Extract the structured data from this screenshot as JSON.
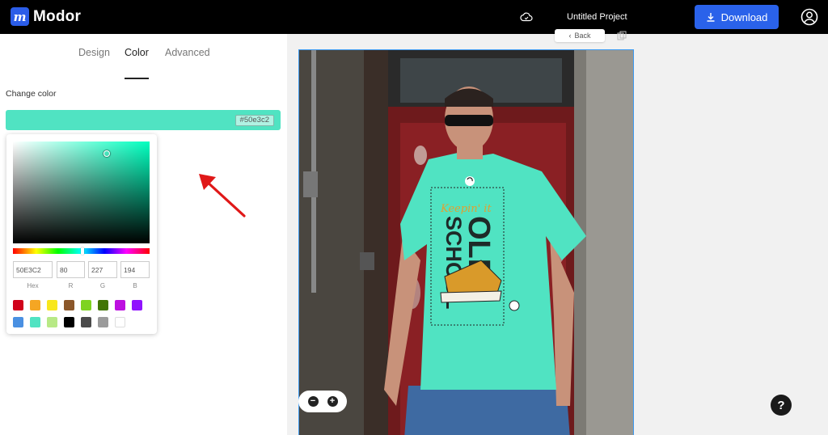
{
  "app": {
    "logo_letter": "m",
    "name": "Modor"
  },
  "header": {
    "project_name": "Untitled Project",
    "download_label": "Download",
    "icons": [
      "cloud-icon",
      "download-icon",
      "user-icon"
    ]
  },
  "tabs": [
    {
      "label": "Design",
      "active": false
    },
    {
      "label": "Color",
      "active": true
    },
    {
      "label": "Advanced",
      "active": false
    }
  ],
  "color_panel": {
    "label": "Change color",
    "current_hex": "#50e3c2",
    "current_color": "#50e3c2"
  },
  "picker": {
    "hex": "50E3C2",
    "r": "80",
    "g": "227",
    "b": "194",
    "labels": {
      "hex": "Hex",
      "r": "R",
      "g": "G",
      "b": "B"
    },
    "swatches": [
      "#d0021b",
      "#f5a623",
      "#f8e71c",
      "#8b572a",
      "#7ed321",
      "#417505",
      "#bd10e0",
      "#9013fe",
      "#4a90e2",
      "#50e3c2",
      "#b8e986",
      "#000000",
      "#4a4a4a",
      "#9b9b9b",
      "#ffffff"
    ]
  },
  "canvas": {
    "back_label": "Back",
    "shirt_color": "#50e3c2",
    "shirt_print_text": "OLD SCHOOL",
    "shirt_script_text": "Keepin' it"
  },
  "colors": {
    "accent": "#2a62ea",
    "selection": "#3e9cf3"
  }
}
